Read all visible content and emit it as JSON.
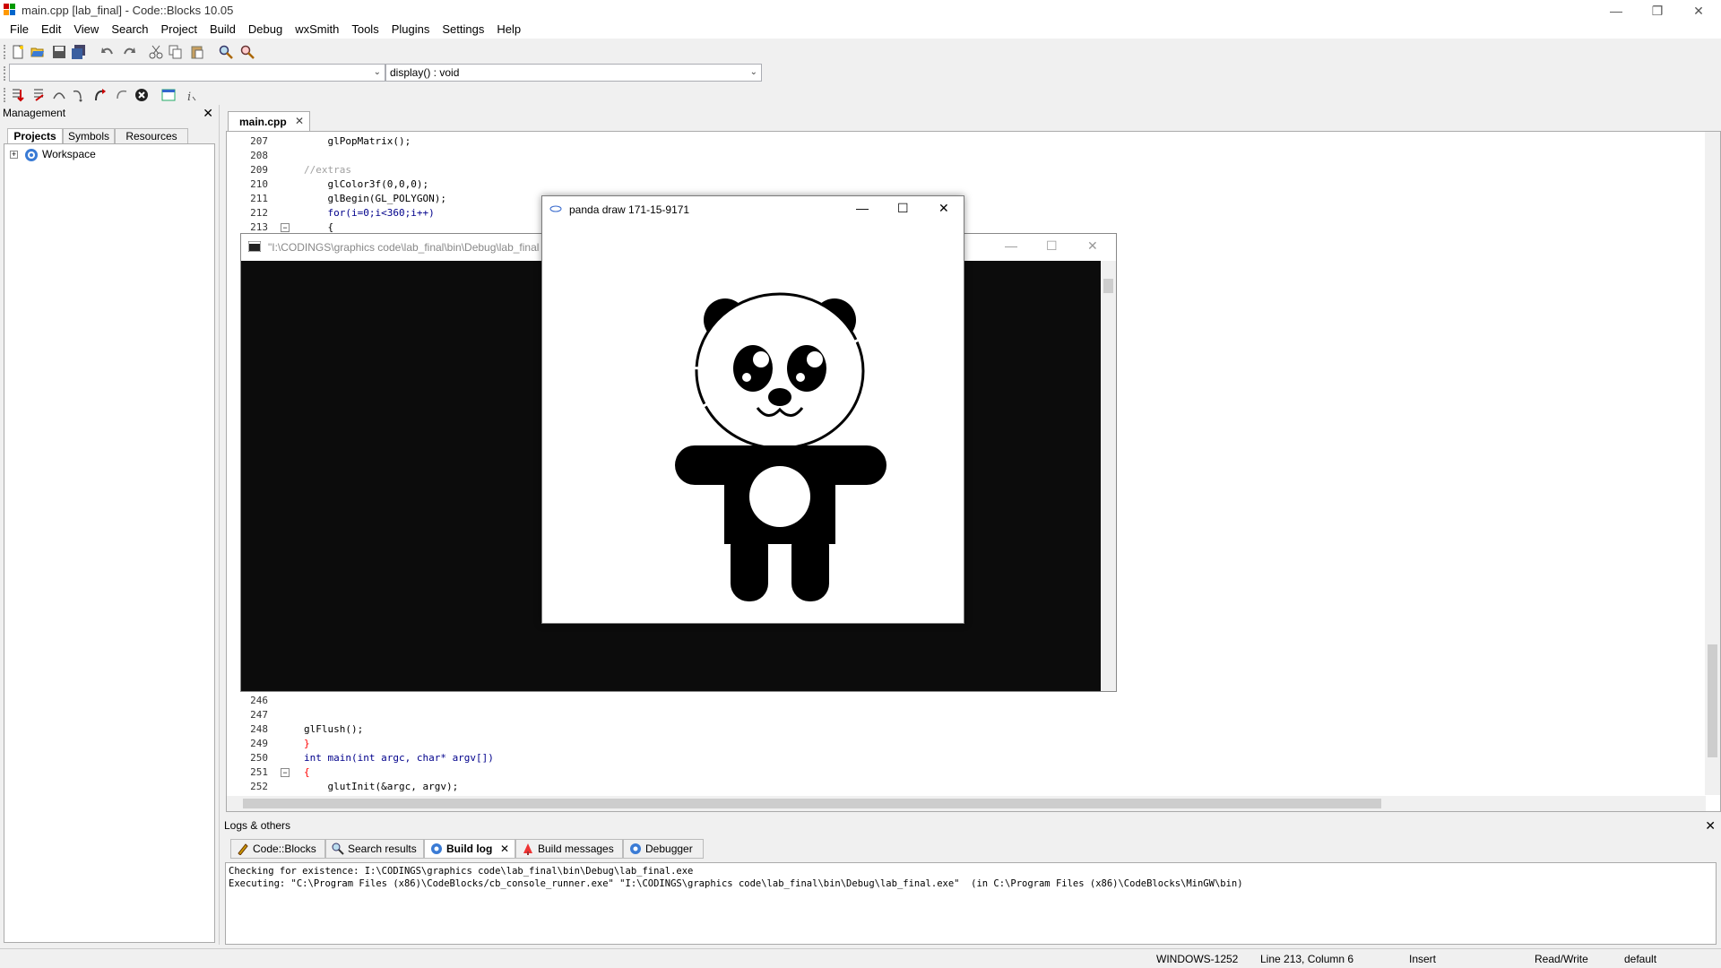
{
  "window": {
    "title": "main.cpp [lab_final] - Code::Blocks 10.05"
  },
  "menu": [
    "File",
    "Edit",
    "View",
    "Search",
    "Project",
    "Build",
    "Debug",
    "wxSmith",
    "Tools",
    "Plugins",
    "Settings",
    "Help"
  ],
  "toolbar": {
    "scope_combo": "",
    "function_combo": "display() : void"
  },
  "management": {
    "title": "Management",
    "tabs": [
      "Projects",
      "Symbols",
      "Resources"
    ],
    "tree_root": "Workspace"
  },
  "editor": {
    "tab_label": "main.cpp",
    "top_lines": [
      {
        "n": "207",
        "text": "    glPopMatrix();"
      },
      {
        "n": "208",
        "text": ""
      },
      {
        "n": "209",
        "text": "//extras"
      },
      {
        "n": "210",
        "text": "    glColor3f(0,0,0);"
      },
      {
        "n": "211",
        "text": "    glBegin(GL_POLYGON);"
      },
      {
        "n": "212",
        "text": "    for(i=0;i<360;i++)"
      },
      {
        "n": "213",
        "text": "    {"
      }
    ],
    "bottom_lines": [
      {
        "n": "246",
        "text": ""
      },
      {
        "n": "247",
        "text": ""
      },
      {
        "n": "248",
        "text": "glFlush();"
      },
      {
        "n": "249",
        "text": "}"
      },
      {
        "n": "250",
        "text": "int main(int argc, char* argv[])"
      },
      {
        "n": "251",
        "text": "{"
      },
      {
        "n": "252",
        "text": "    glutInit(&argc, argv);"
      }
    ]
  },
  "console_window": {
    "title": "\"I:\\CODINGS\\graphics code\\lab_final\\bin\\Debug\\lab_final"
  },
  "panda_window": {
    "title": "panda draw 171-15-9171"
  },
  "logs": {
    "title": "Logs & others",
    "tabs": [
      "Code::Blocks",
      "Search results",
      "Build log",
      "Build messages",
      "Debugger"
    ],
    "active_tab": "Build log",
    "lines": [
      "Checking for existence: I:\\CODINGS\\graphics code\\lab_final\\bin\\Debug\\lab_final.exe",
      "Executing: \"C:\\Program Files (x86)\\CodeBlocks/cb_console_runner.exe\" \"I:\\CODINGS\\graphics code\\lab_final\\bin\\Debug\\lab_final.exe\"  (in C:\\Program Files (x86)\\CodeBlocks\\MinGW\\bin)"
    ]
  },
  "status": {
    "encoding": "WINDOWS-1252",
    "position": "Line 213, Column 6",
    "mode": "Insert",
    "access": "Read/Write",
    "profile": "default"
  }
}
